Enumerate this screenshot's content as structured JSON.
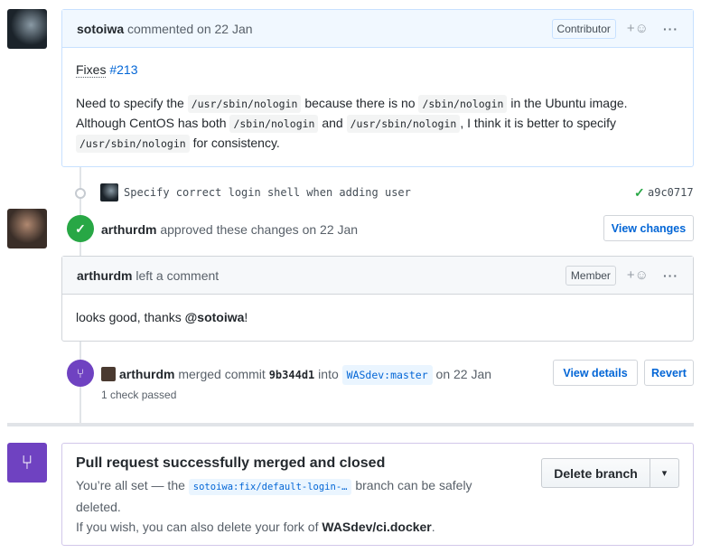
{
  "comment1": {
    "author": "sotoiwa",
    "action": "commented on 22 Jan",
    "badge": "Contributor",
    "reaction": "+☺",
    "more": "···",
    "fixes": "Fixes",
    "issue": "#213",
    "p1": "Need to specify the ",
    "c1": "/usr/sbin/nologin",
    "p2": " because there is no ",
    "c2": "/sbin/nologin",
    "p3": " in the Ubuntu image.",
    "p4": "Although CentOS has both ",
    "c3": "/sbin/nologin",
    "p5": " and ",
    "c4": "/usr/sbin/nologin",
    "p6": ", I think it is better to specify",
    "c5": "/usr/sbin/nologin",
    "p7": " for consistency."
  },
  "commit": {
    "message": "Specify correct login shell when adding user",
    "check": "✓",
    "hash": "a9c0717"
  },
  "review": {
    "author": "arthurdm",
    "action": "approved these changes on 22 Jan",
    "button": "View changes"
  },
  "comment2": {
    "author": "arthurdm",
    "action": "left a comment",
    "badge": "Member",
    "reaction": "+☺",
    "more": "···",
    "t1": "looks good, thanks ",
    "mention": "@sotoiwa",
    "t2": "!"
  },
  "merge": {
    "author": "arthurdm",
    "t1": " merged commit ",
    "commit": "9b344d1",
    "t2": " into ",
    "branch": "WASdev:master",
    "t3": " on 22 Jan",
    "checks": "1 check passed",
    "view_details": "View details",
    "revert": "Revert"
  },
  "closed": {
    "title": "Pull request successfully merged and closed",
    "t1": "You’re all set — the ",
    "branch": "sotoiwa:fix/default-login-…",
    "t2": " branch can be safely",
    "t3": "deleted.",
    "t4": "If you wish, you can also delete your fork of ",
    "repo": "WASdev/ci.docker",
    "t5": ".",
    "delete_button": "Delete branch",
    "dropdown": "▾"
  }
}
